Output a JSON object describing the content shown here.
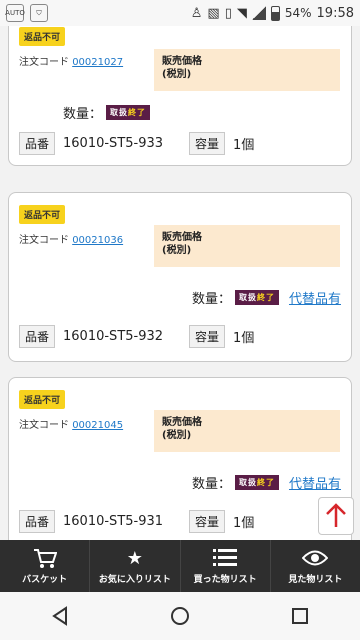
{
  "status_bar": {
    "battery": "54%",
    "time": "19:58",
    "app_icon_text": "AUTO"
  },
  "cards": [
    {
      "badge": "返品不可",
      "order_label": "注文コード",
      "order_code": "00021027",
      "price_line1": "販売価格",
      "price_line2": "(税別)",
      "qty_label": "数量：",
      "status_badge_a": "取扱",
      "status_badge_b": "終了",
      "part_label": "品番",
      "part_no": "16010-ST5-933",
      "capacity_label": "容量",
      "capacity": "1個"
    },
    {
      "badge": "返品不可",
      "order_label": "注文コード",
      "order_code": "00021036",
      "price_line1": "販売価格",
      "price_line2": "(税別)",
      "qty_label": "数量：",
      "status_badge_a": "取扱",
      "status_badge_b": "終了",
      "alt_link": "代替品有",
      "part_label": "品番",
      "part_no": "16010-ST5-932",
      "capacity_label": "容量",
      "capacity": "1個"
    },
    {
      "badge": "返品不可",
      "order_label": "注文コード",
      "order_code": "00021045",
      "price_line1": "販売価格",
      "price_line2": "(税別)",
      "qty_label": "数量：",
      "status_badge_a": "取扱",
      "status_badge_b": "終了",
      "alt_link": "代替品有",
      "part_label": "品番",
      "part_no": "16010-ST5-931",
      "capacity_label": "容量",
      "capacity": "1個"
    }
  ],
  "tabbar": {
    "basket": "バスケット",
    "favorites": "お気に入りリスト",
    "purchased": "買った物リスト",
    "viewed": "見た物リスト"
  },
  "colors": {
    "badge_yellow": "#f7d21d",
    "price_bg": "#fce9cf",
    "ended_purple": "#5a1d46",
    "link_blue": "#1f78c8",
    "tabbar_bg": "#2e2e2e",
    "up_arrow_red": "#d6262b"
  }
}
